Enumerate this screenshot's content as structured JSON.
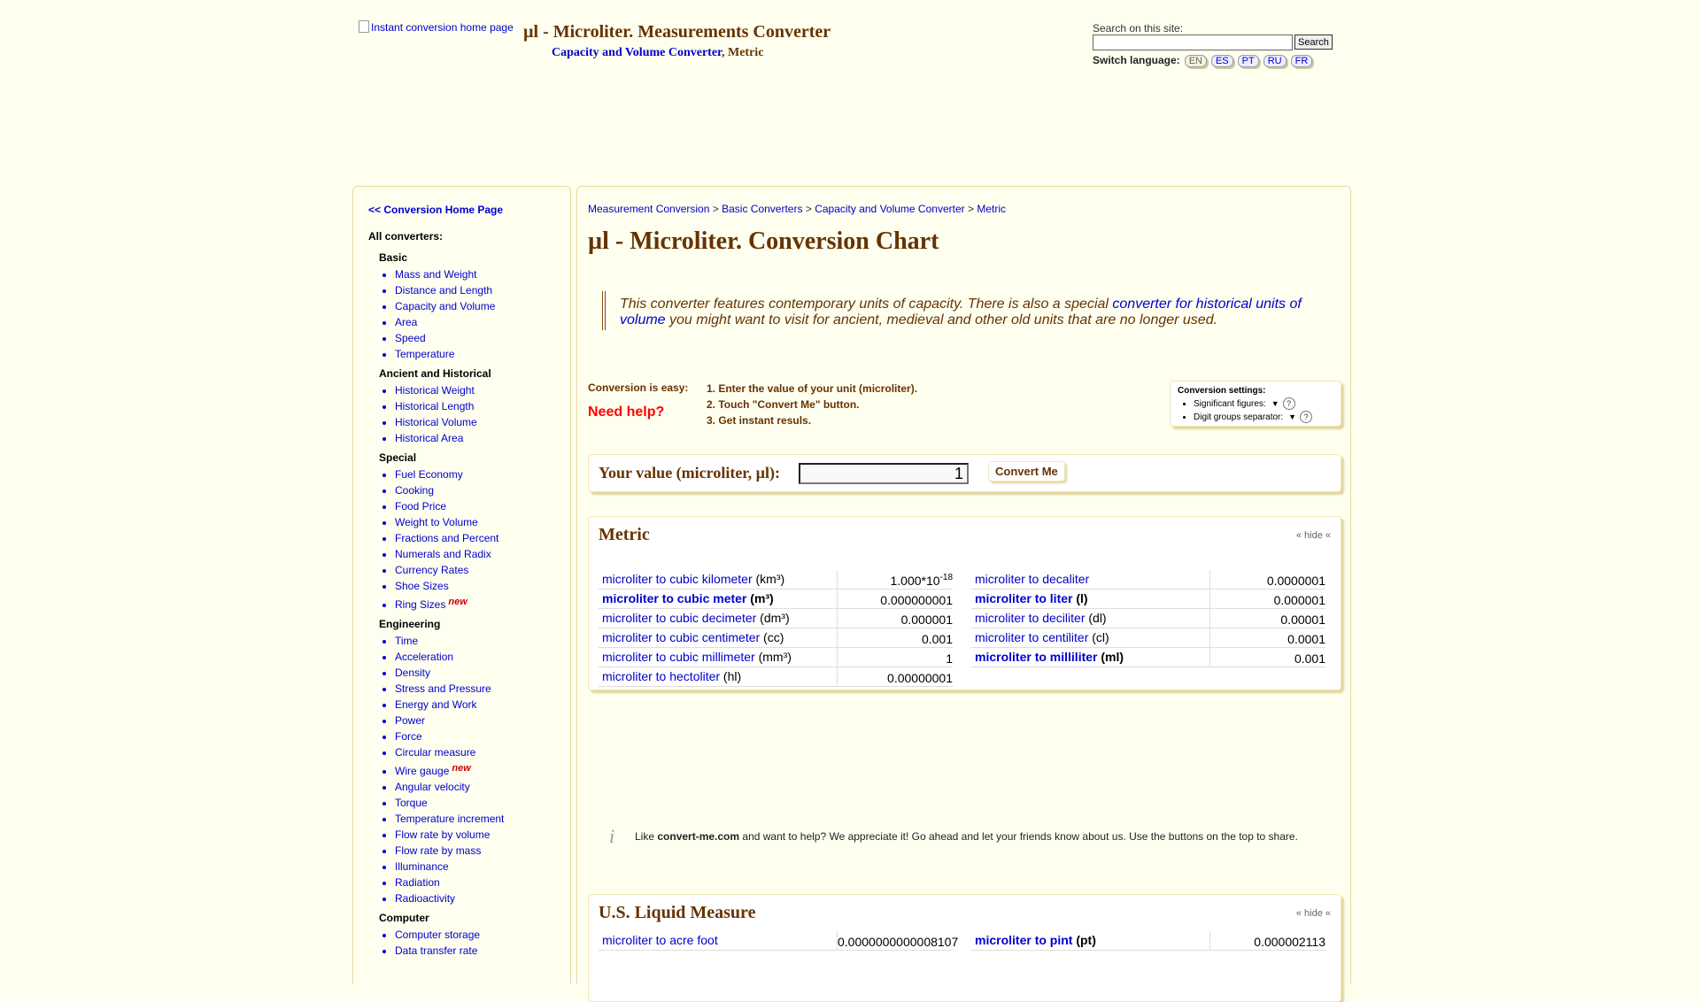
{
  "header": {
    "logo_alt": "Instant conversion home page",
    "title": "µl - Microliter. Measurements Converter",
    "subtitle_link": "Capacity and Volume Converter",
    "subtitle_rest": ", Metric"
  },
  "search": {
    "label": "Search on this site:",
    "value": "",
    "button": "Search"
  },
  "language": {
    "label": "Switch language:",
    "options": [
      "EN",
      "ES",
      "PT",
      "RU",
      "FR"
    ],
    "active": "EN"
  },
  "sidebar": {
    "home_link": "<< Conversion Home Page",
    "all_label": "All converters:",
    "groups": [
      {
        "title": "Basic",
        "items": [
          "Mass and Weight",
          "Distance and Length",
          "Capacity and Volume",
          "Area",
          "Speed",
          "Temperature"
        ]
      },
      {
        "title": "Ancient and Historical",
        "items": [
          "Historical Weight",
          "Historical Length",
          "Historical Volume",
          "Historical Area"
        ]
      },
      {
        "title": "Special",
        "items": [
          "Fuel Economy",
          "Cooking",
          "Food Price",
          "Weight to Volume",
          "Fractions and Percent",
          "Numerals and Radix",
          "Currency Rates",
          "Shoe Sizes",
          "Ring Sizes"
        ]
      },
      {
        "title": "Engineering",
        "items": [
          "Time",
          "Acceleration",
          "Density",
          "Stress and Pressure",
          "Energy and Work",
          "Power",
          "Force",
          "Circular measure",
          "Wire gauge",
          "Angular velocity",
          "Torque",
          "Temperature increment",
          "Flow rate by volume",
          "Flow rate by mass",
          "Illuminance",
          "Radiation",
          "Radioactivity"
        ]
      },
      {
        "title": "Computer",
        "items": [
          "Computer storage",
          "Data transfer rate"
        ]
      }
    ],
    "new_badge": "new"
  },
  "breadcrumb": {
    "items": [
      "Measurement Conversion",
      "Basic Converters",
      "Capacity and Volume Converter",
      "Metric"
    ],
    "separator": ">"
  },
  "page_title": "µl - Microliter. Conversion Chart",
  "intro": {
    "before": "This converter features contemporary units of capacity. There is also a special ",
    "link": "converter for historical units of volume",
    "after": " you might want to visit for ancient, medieval and other old units that are no longer used."
  },
  "instructions": {
    "easy_label": "Conversion is easy:",
    "need_help": "Need help?",
    "steps": [
      "1. Enter the value of your unit (microliter).",
      "2. Touch \"Convert Me\" button.",
      "3. Get instant resuls."
    ]
  },
  "settings": {
    "title": "Conversion settings:",
    "sig_label": "Significant figures:",
    "sep_label": "Digit groups separator:",
    "help": "?"
  },
  "value_form": {
    "label": "Your value (microliter, µl):",
    "value": "1",
    "button": "Convert Me"
  },
  "metric": {
    "title": "Metric",
    "hide": "« hide «",
    "left": [
      {
        "link": "microliter to cubic kilometer",
        "unit": " (km³)",
        "value": "1.000*10",
        "exp": "-18",
        "bold": false
      },
      {
        "link": "microliter to cubic meter",
        "unit": " (m³)",
        "value": "0.000000001",
        "exp": "",
        "bold": true
      },
      {
        "link": "microliter to cubic decimeter",
        "unit": " (dm³)",
        "value": "0.000001",
        "exp": "",
        "bold": false
      },
      {
        "link": "microliter to cubic centimeter",
        "unit": " (cc)",
        "value": "0.001",
        "exp": "",
        "bold": false
      },
      {
        "link": "microliter to cubic millimeter",
        "unit": " (mm³)",
        "value": "1",
        "exp": "",
        "bold": false
      },
      {
        "link": "microliter to hectoliter",
        "unit": " (hl)",
        "value": "0.00000001",
        "exp": "",
        "bold": false
      }
    ],
    "right": [
      {
        "link": "microliter to decaliter",
        "unit": "",
        "value": "0.0000001",
        "exp": "",
        "bold": false
      },
      {
        "link": "microliter to liter",
        "unit": " (l)",
        "value": "0.000001",
        "exp": "",
        "bold": true
      },
      {
        "link": "microliter to deciliter",
        "unit": " (dl)",
        "value": "0.00001",
        "exp": "",
        "bold": false
      },
      {
        "link": "microliter to centiliter",
        "unit": " (cl)",
        "value": "0.0001",
        "exp": "",
        "bold": false
      },
      {
        "link": "microliter to milliliter",
        "unit": " (ml)",
        "value": "0.001",
        "exp": "",
        "bold": true
      }
    ]
  },
  "share": {
    "icon": "i",
    "before": "Like ",
    "site": "convert-me.com",
    "after": " and want to help? We appreciate it! Go ahead and let your friends know about us. Use the buttons on the top to share."
  },
  "us_liquid": {
    "title": "U.S. Liquid Measure",
    "hide": "« hide «",
    "left": [
      {
        "link": "microliter to acre foot",
        "unit": "",
        "value": "0.0000000000008107",
        "exp": "",
        "bold": false
      }
    ],
    "right": [
      {
        "link": "microliter to pint",
        "unit": " (pt)",
        "value": "0.000002113",
        "exp": "",
        "bold": true
      }
    ]
  }
}
